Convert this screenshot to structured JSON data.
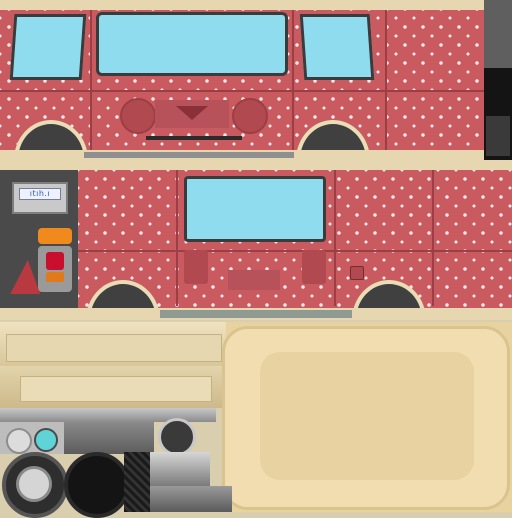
{
  "sheet": {
    "type": "vehicle-texture-atlas",
    "paint_color": "#c95a5f",
    "dot_color": "#f4eaea",
    "window_color": "#8fdcef",
    "trim_color": "#e6d7b0",
    "interior_color": "#e8d3a0"
  },
  "sign": {
    "top_text": "",
    "body_text": "ıtıh.ı"
  }
}
